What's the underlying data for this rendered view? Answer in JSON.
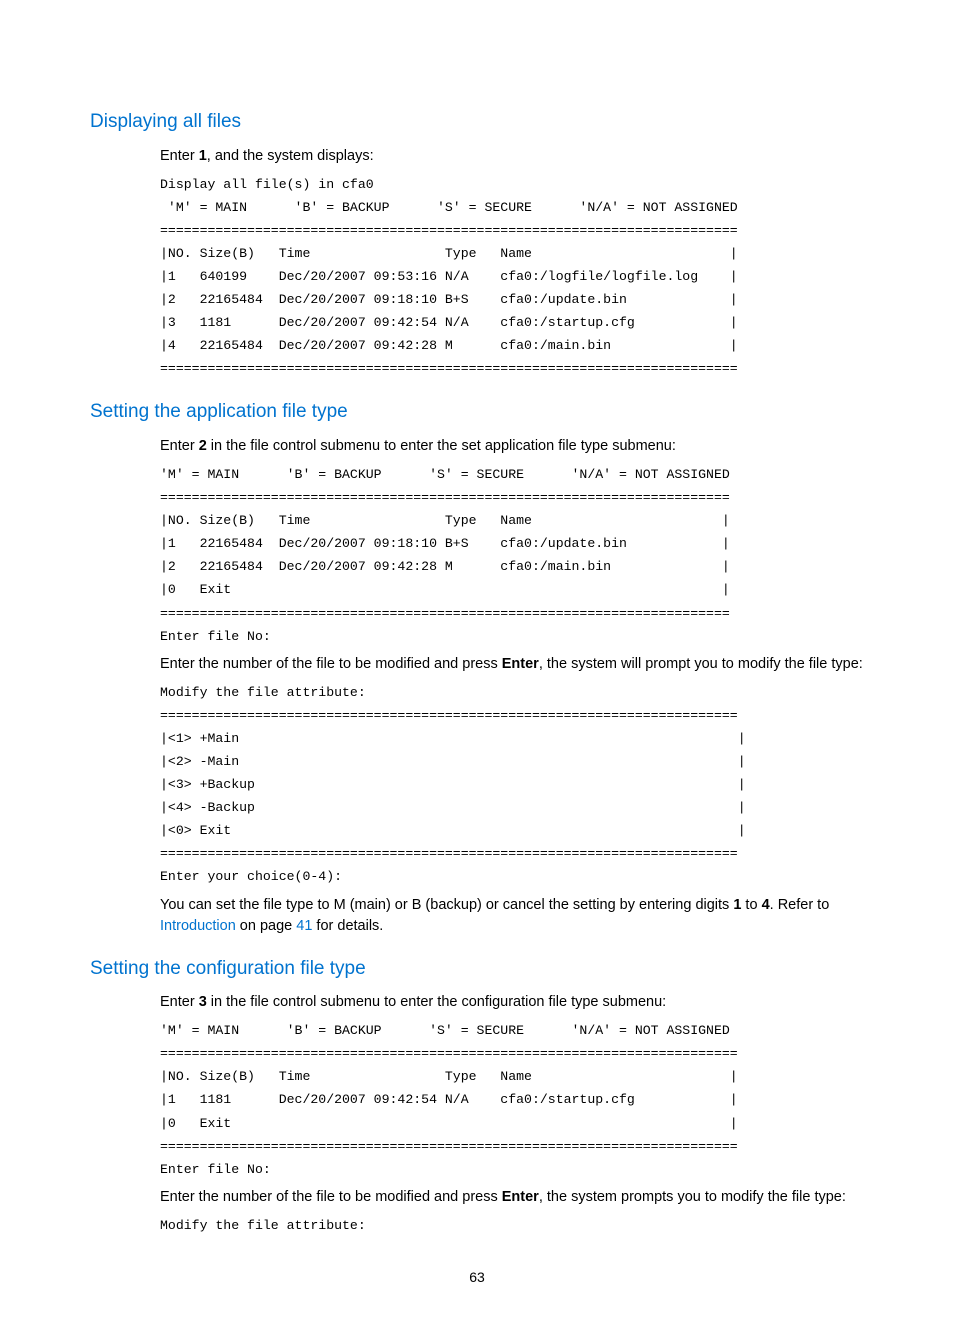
{
  "section1": {
    "heading": "Displaying all files",
    "para1_a": "Enter ",
    "para1_b": "1",
    "para1_c": ", and the system displays:",
    "code": "Display all file(s) in cfa0\n 'M' = MAIN      'B' = BACKUP      'S' = SECURE      'N/A' = NOT ASSIGNED\n=========================================================================\n|NO. Size(B)   Time                 Type   Name                         |\n|1   640199    Dec/20/2007 09:53:16 N/A    cfa0:/logfile/logfile.log    |\n|2   22165484  Dec/20/2007 09:18:10 B+S    cfa0:/update.bin             |\n|3   1181      Dec/20/2007 09:42:54 N/A    cfa0:/startup.cfg            |\n|4   22165484  Dec/20/2007 09:42:28 M      cfa0:/main.bin               |\n========================================================================="
  },
  "section2": {
    "heading": "Setting the application file type",
    "para1_a": "Enter ",
    "para1_b": "2",
    "para1_c": " in the file control submenu to enter the set application file type submenu:",
    "code1": "'M' = MAIN      'B' = BACKUP      'S' = SECURE      'N/A' = NOT ASSIGNED\n========================================================================\n|NO. Size(B)   Time                 Type   Name                        |\n|1   22165484  Dec/20/2007 09:18:10 B+S    cfa0:/update.bin            |\n|2   22165484  Dec/20/2007 09:42:28 M      cfa0:/main.bin              |\n|0   Exit                                                              |\n========================================================================\nEnter file No:",
    "para2_a": "Enter the number of the file to be modified and press ",
    "para2_b": "Enter",
    "para2_c": ", the system will prompt you to modify the file type:",
    "code2": "Modify the file attribute:\n=========================================================================\n|<1> +Main                                                               |\n|<2> -Main                                                               |\n|<3> +Backup                                                             |\n|<4> -Backup                                                             |\n|<0> Exit                                                                |\n=========================================================================\nEnter your choice(0-4):",
    "para3_a": "You can set the file type to M (main) or B (backup) or cancel the setting by entering digits ",
    "para3_b": "1",
    "para3_c": " to ",
    "para3_d": "4",
    "para3_e": ". Refer to ",
    "link1": "Introduction",
    "para3_f": " on page ",
    "link2": "41",
    "para3_g": " for details."
  },
  "section3": {
    "heading": "Setting the configuration file type",
    "para1_a": "Enter ",
    "para1_b": "3",
    "para1_c": " in the file control submenu to enter the configuration file type submenu:",
    "code1": "'M' = MAIN      'B' = BACKUP      'S' = SECURE      'N/A' = NOT ASSIGNED\n=========================================================================\n|NO. Size(B)   Time                 Type   Name                         |\n|1   1181      Dec/20/2007 09:42:54 N/A    cfa0:/startup.cfg            |\n|0   Exit                                                               |\n=========================================================================\nEnter file No:",
    "para2_a": "Enter the number of the file to be modified and press ",
    "para2_b": "Enter",
    "para2_c": ", the system prompts you to modify the file type:",
    "code2": "Modify the file attribute:"
  },
  "page_number": "63"
}
